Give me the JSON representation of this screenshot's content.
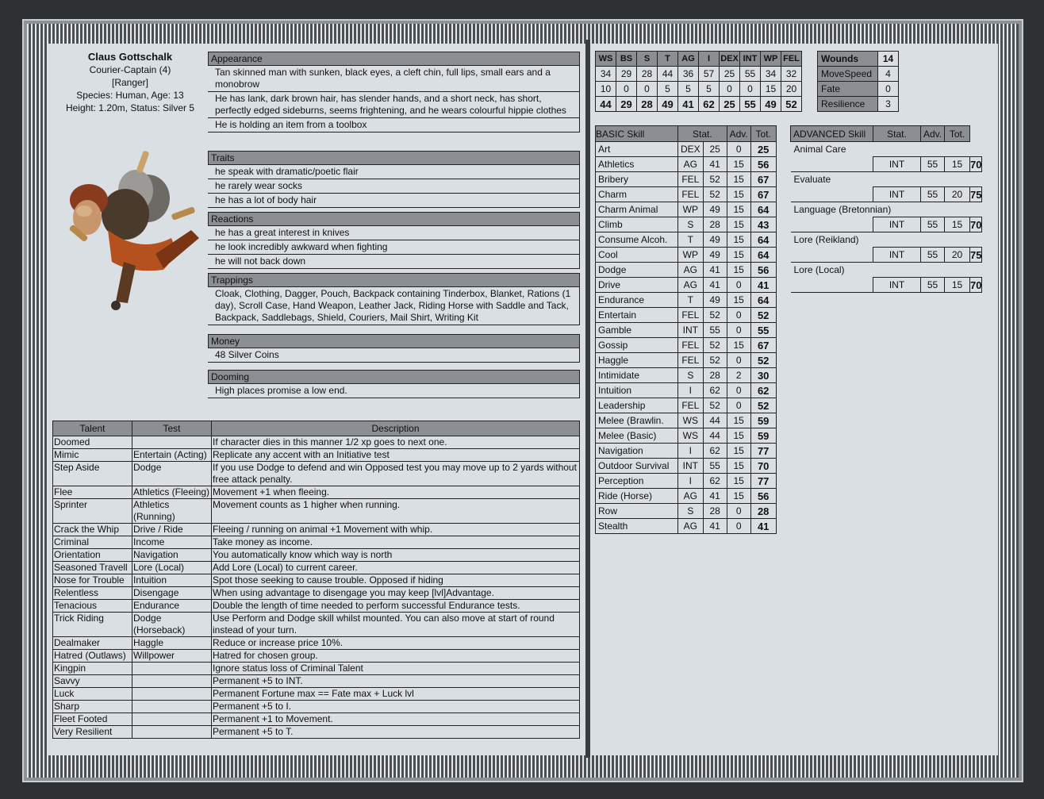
{
  "character": {
    "name": "Claus Gottschalk",
    "career": "Courier-Captain (4)",
    "class": "[Ranger]",
    "species_age": "Species: Human, Age: 13",
    "height_status": "Height: 1.20m, Status: Silver 5"
  },
  "sections": {
    "appearance": {
      "title": "Appearance",
      "rows": [
        "Tan skinned man with sunken, black eyes, a cleft chin, full lips, small ears and a monobrow",
        "He has lank, dark brown hair, has slender hands, and a short neck, has short, perfectly edged sideburns, seems frightening, and he wears colourful hippie clothes",
        "He is holding an item from a toolbox"
      ]
    },
    "traits": {
      "title": "Traits",
      "rows": [
        "he speak with dramatic/poetic flair",
        "he rarely wear socks",
        "he has a lot of body hair"
      ]
    },
    "reactions": {
      "title": "Reactions",
      "rows": [
        "he has a great interest in knives",
        "he look incredibly awkward when fighting",
        "he will not back down"
      ]
    },
    "trappings": {
      "title": "Trappings",
      "rows": [
        "Cloak, Clothing, Dagger, Pouch, Backpack containing Tinderbox, Blanket, Rations (1 day), Scroll Case, Hand Weapon, Leather Jack, Riding Horse with Saddle and Tack, Backpack, Saddlebags, Shield, Couriers, Mail Shirt, Writing Kit"
      ]
    },
    "money": {
      "title": "Money",
      "rows": [
        "48 Silver Coins"
      ]
    },
    "dooming": {
      "title": "Dooming",
      "rows": [
        "High places promise a low end."
      ]
    }
  },
  "talents": {
    "headers": [
      "Talent",
      "Test",
      "Description"
    ],
    "rows": [
      [
        "Doomed",
        "",
        "If character dies in this manner 1/2 xp goes to next one."
      ],
      [
        "Mimic",
        "Entertain (Acting)",
        "Replicate any accent with an Initiative test"
      ],
      [
        "Step Aside",
        "Dodge",
        "If you use Dodge to defend and win Opposed test you may move up to 2 yards without free attack penalty."
      ],
      [
        "Flee",
        "Athletics (Fleeing)",
        "Movement +1 when fleeing."
      ],
      [
        "Sprinter",
        "Athletics (Running)",
        "Movement counts as 1 higher when running."
      ],
      [
        "Crack the Whip",
        "Drive / Ride",
        "Fleeing / running on animal +1 Movement with whip."
      ],
      [
        "Criminal",
        "Income",
        "Take money as income."
      ],
      [
        "Orientation",
        "Navigation",
        "You automatically know which way is north"
      ],
      [
        "Seasoned Travell",
        "Lore (Local)",
        "Add Lore (Local) to current career."
      ],
      [
        "Nose for Trouble",
        "Intuition",
        "Spot those seeking to cause trouble. Opposed if hiding"
      ],
      [
        "Relentless",
        "Disengage",
        "When using advantage to disengage you may keep [lvl]Advantage."
      ],
      [
        "Tenacious",
        "Endurance",
        "Double the length of time needed to perform successful Endurance tests."
      ],
      [
        "Trick Riding",
        "Dodge (Horseback)",
        "Use Perform and Dodge skill whilst mounted. You can also move at start of round instead of your turn."
      ],
      [
        "Dealmaker",
        "Haggle",
        "Reduce or increase price 10%."
      ],
      [
        "Hatred (Outlaws)",
        "Willpower",
        "Hatred for chosen group."
      ],
      [
        "Kingpin",
        "",
        "Ignore status loss of Criminal Talent"
      ],
      [
        "Savvy",
        "",
        "Permanent +5 to INT."
      ],
      [
        "Luck",
        "",
        "Permanent Fortune max == Fate max + Luck lvl"
      ],
      [
        "Sharp",
        "",
        "Permanent +5 to I."
      ],
      [
        "Fleet Footed",
        "",
        "Permanent +1 to Movement."
      ],
      [
        "Very Resilient",
        "",
        "Permanent +5 to T."
      ]
    ]
  },
  "characteristics": {
    "headers": [
      "WS",
      "BS",
      "S",
      "T",
      "AG",
      "I",
      "DEX",
      "INT",
      "WP",
      "FEL"
    ],
    "base": [
      "34",
      "29",
      "28",
      "44",
      "36",
      "57",
      "25",
      "55",
      "34",
      "32"
    ],
    "advances": [
      "10",
      "0",
      "0",
      "5",
      "5",
      "5",
      "0",
      "0",
      "15",
      "20"
    ],
    "total": [
      "44",
      "29",
      "28",
      "49",
      "41",
      "62",
      "25",
      "55",
      "49",
      "52"
    ]
  },
  "vitals": [
    [
      "Wounds",
      "14"
    ],
    [
      "MoveSpeed",
      "4"
    ],
    [
      "Fate",
      "0"
    ],
    [
      "Resilience",
      "3"
    ]
  ],
  "basic_skills": {
    "headers": [
      "BASIC Skill",
      "Stat.",
      "Adv.",
      "Tot."
    ],
    "rows": [
      [
        "Art",
        "DEX",
        "25",
        "0",
        "25"
      ],
      [
        "Athletics",
        "AG",
        "41",
        "15",
        "56"
      ],
      [
        "Bribery",
        "FEL",
        "52",
        "15",
        "67"
      ],
      [
        "Charm",
        "FEL",
        "52",
        "15",
        "67"
      ],
      [
        "Charm Animal",
        "WP",
        "49",
        "15",
        "64"
      ],
      [
        "Climb",
        "S",
        "28",
        "15",
        "43"
      ],
      [
        "Consume Alcoh.",
        "T",
        "49",
        "15",
        "64"
      ],
      [
        "Cool",
        "WP",
        "49",
        "15",
        "64"
      ],
      [
        "Dodge",
        "AG",
        "41",
        "15",
        "56"
      ],
      [
        "Drive",
        "AG",
        "41",
        "0",
        "41"
      ],
      [
        "Endurance",
        "T",
        "49",
        "15",
        "64"
      ],
      [
        "Entertain",
        "FEL",
        "52",
        "0",
        "52"
      ],
      [
        "Gamble",
        "INT",
        "55",
        "0",
        "55"
      ],
      [
        "Gossip",
        "FEL",
        "52",
        "15",
        "67"
      ],
      [
        "Haggle",
        "FEL",
        "52",
        "0",
        "52"
      ],
      [
        "Intimidate",
        "S",
        "28",
        "2",
        "30"
      ],
      [
        "Intuition",
        "I",
        "62",
        "0",
        "62"
      ],
      [
        "Leadership",
        "FEL",
        "52",
        "0",
        "52"
      ],
      [
        "Melee (Brawlin.",
        "WS",
        "44",
        "15",
        "59"
      ],
      [
        "Melee (Basic)",
        "WS",
        "44",
        "15",
        "59"
      ],
      [
        "Navigation",
        "I",
        "62",
        "15",
        "77"
      ],
      [
        "Outdoor Survival",
        "INT",
        "55",
        "15",
        "70"
      ],
      [
        "Perception",
        "I",
        "62",
        "15",
        "77"
      ],
      [
        "Ride (Horse)",
        "AG",
        "41",
        "15",
        "56"
      ],
      [
        "Row",
        "S",
        "28",
        "0",
        "28"
      ],
      [
        "Stealth",
        "AG",
        "41",
        "0",
        "41"
      ]
    ]
  },
  "advanced_skills": {
    "headers": [
      "ADVANCED Skill",
      "Stat.",
      "Adv.",
      "Tot."
    ],
    "rows": [
      [
        "Animal Care",
        "INT",
        "55",
        "15",
        "70"
      ],
      [
        "Evaluate",
        "INT",
        "55",
        "20",
        "75"
      ],
      [
        "Language (Bretonnian)",
        "INT",
        "55",
        "15",
        "70"
      ],
      [
        "Lore (Reikland)",
        "INT",
        "55",
        "20",
        "75"
      ],
      [
        "Lore (Local)",
        "INT",
        "55",
        "15",
        "70"
      ]
    ]
  }
}
